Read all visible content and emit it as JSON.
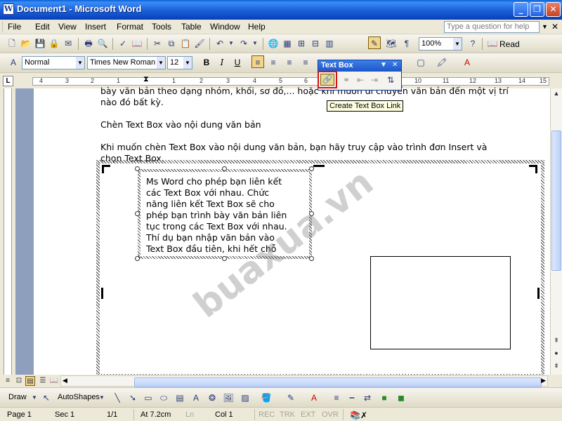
{
  "window": {
    "title": "Document1 - Microsoft Word",
    "min": "_",
    "max": "❐",
    "close": "✕"
  },
  "menu": {
    "items": [
      "File",
      "Edit",
      "View",
      "Insert",
      "Format",
      "Tools",
      "Table",
      "Window",
      "Help"
    ],
    "ask_placeholder": "Type a question for help",
    "close": "✕"
  },
  "standard_toolbar": {
    "zoom": "100%",
    "read_label": "Read"
  },
  "format_toolbar": {
    "style": "Normal",
    "font": "Times New Roman",
    "size": "12",
    "bold": "B",
    "italic": "I",
    "underline": "U"
  },
  "ruler": {
    "tab_selector": "L",
    "numbers": [
      "4",
      "3",
      "2",
      "1",
      "1",
      "2",
      "3",
      "4",
      "5",
      "6",
      "10",
      "11",
      "12",
      "13",
      "14",
      "15"
    ]
  },
  "document": {
    "para1_line1": "bày văn bản theo dạng nhóm, khối, sơ đồ,... hoặc khi muốn di chuyển văn bản đến một vị trí",
    "para1_line2": "nào đó bất kỳ.",
    "para2": "Chèn Text Box vào nội dung văn bản",
    "para3_line1": "Khi muốn chèn Text Box vào nội dung văn bản, bạn hãy truy cập vào trình đơn Insert và",
    "para3_line2": "chọn Text Box.",
    "textbox_lines": [
      "Ms Word cho phép bạn liên kết",
      "các Text Box với nhau. Chức",
      "năng liên kết Text Box sẽ cho",
      "phép bạn trình bày văn bản liên",
      "tục trong các Text Box với nhau.",
      "Thí dụ bạn nhập văn bản vào",
      "Text Box đầu tiên, khi hết chỗ"
    ],
    "watermark": "buaxua.vn"
  },
  "textbox_toolbar": {
    "title": "Text Box",
    "tooltip": "Create Text Box Link"
  },
  "drawing_toolbar": {
    "draw_label": "Draw",
    "autoshapes_label": "AutoShapes"
  },
  "status": {
    "page": "Page 1",
    "sec": "Sec 1",
    "pages": "1/1",
    "at": "At 7.2cm",
    "ln": "Ln",
    "col": "Col 1",
    "rec": "REC",
    "trk": "TRK",
    "ext": "EXT",
    "ovr": "OVR"
  },
  "colors": {
    "title_bar": "#1d63dc",
    "link_button_highlight": "#d01515",
    "tooltip_bg": "#ffffe1",
    "doc_background": "#8e9fbd"
  }
}
